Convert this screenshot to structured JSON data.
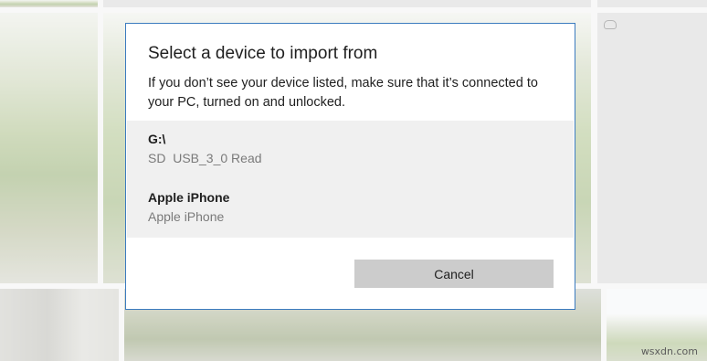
{
  "dialog": {
    "title": "Select a device to import from",
    "description": "If you don’t see your device listed, make sure that it’s connected to your PC, turned on and unlocked.",
    "devices": [
      {
        "name": "G:\\",
        "subtitle": "SD  USB_3_0 Read"
      },
      {
        "name": "Apple iPhone",
        "subtitle": "Apple iPhone"
      }
    ],
    "cancel_label": "Cancel"
  },
  "background": {
    "cloud_icon": "cloud-icon"
  },
  "watermark": "wsxdn.com",
  "colors": {
    "dialog_border": "#3b7bbf",
    "list_background": "#f0f0f0",
    "cancel_button": "#cccccc"
  }
}
